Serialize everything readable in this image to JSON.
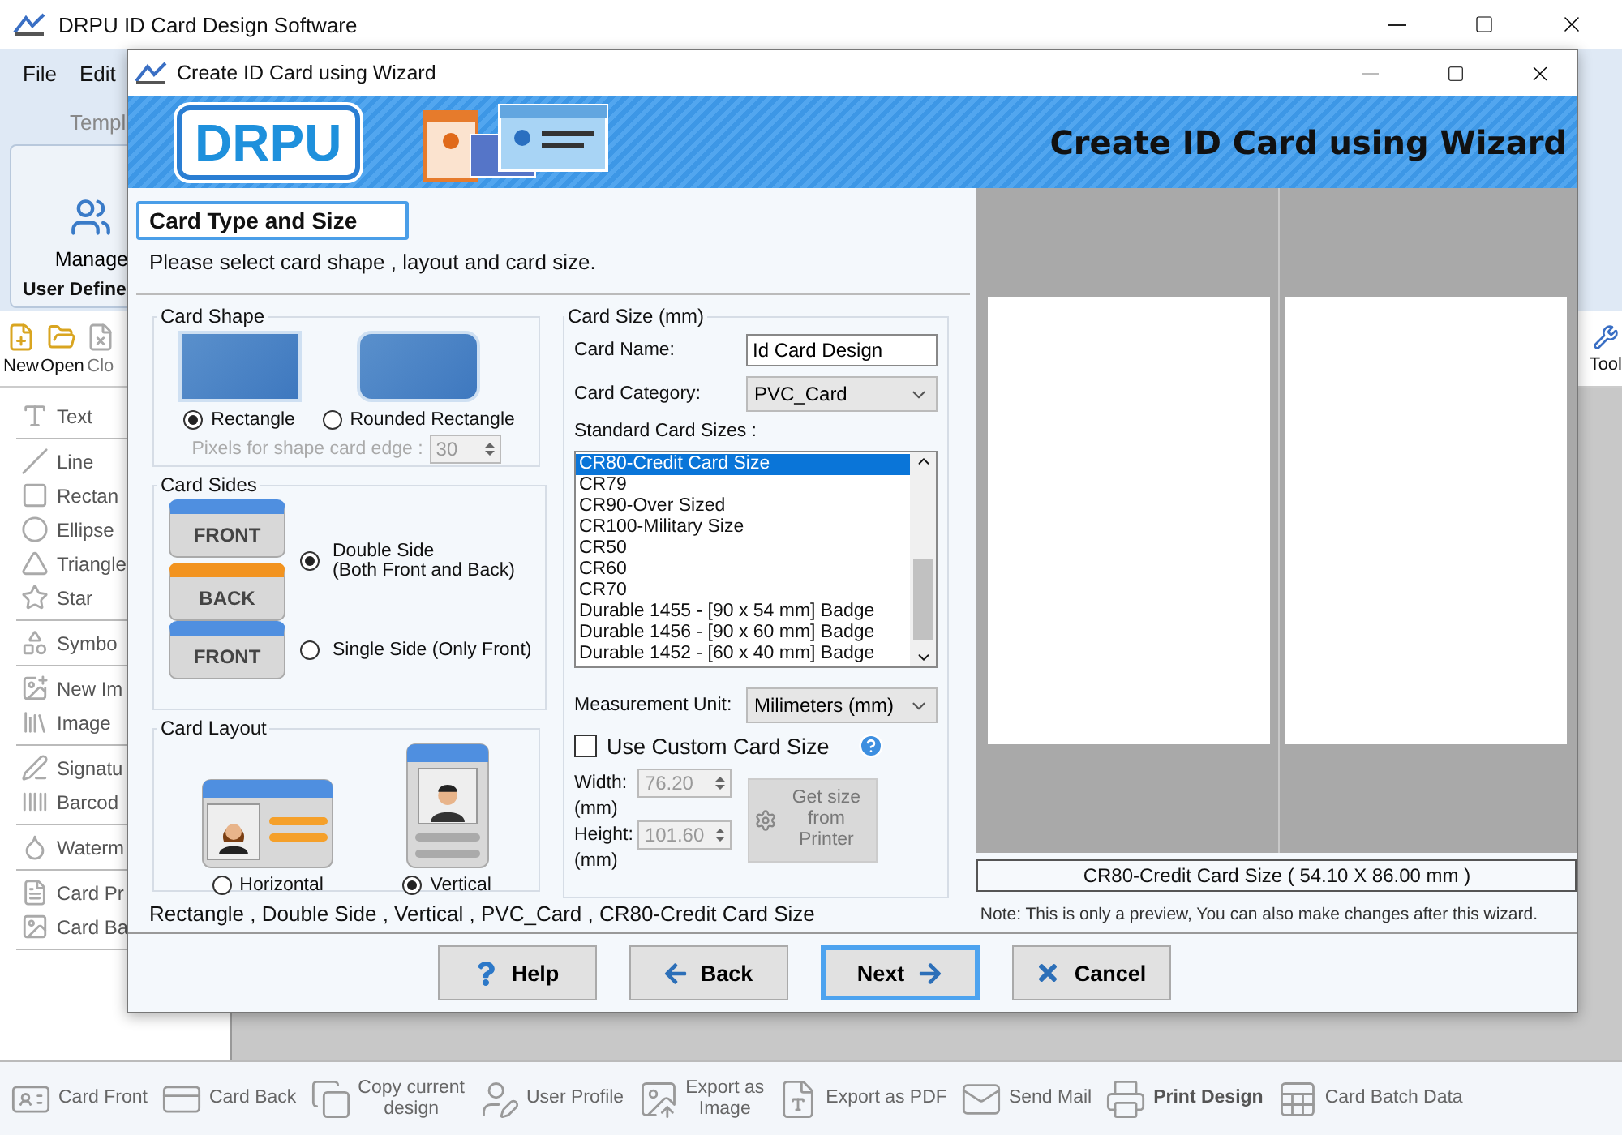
{
  "app": {
    "title": "DRPU ID Card Design Software",
    "menu": [
      "File",
      "Edit"
    ],
    "ribbon_tab": "Templ",
    "ribbon_group": {
      "button": "Manage",
      "label": "User Define"
    },
    "toolbar": [
      {
        "label": "New",
        "disabled": false
      },
      {
        "label": "Open",
        "disabled": false
      },
      {
        "label": "Clo",
        "disabled": true
      }
    ],
    "toolbar_right": "Tool",
    "tool_groups": [
      {
        "items": [
          "Text"
        ]
      },
      {
        "items": [
          "Line",
          "Rectan",
          "Ellipse",
          "Triangle",
          "Star"
        ]
      },
      {
        "items": [
          "Symbo"
        ]
      },
      {
        "items": [
          "New Im",
          "Image"
        ]
      },
      {
        "items": [
          "Signatu",
          "Barcod"
        ]
      },
      {
        "items": [
          "Waterm"
        ]
      },
      {
        "items": [
          "Card Pr",
          "Card Ba"
        ]
      }
    ],
    "bottom_bar": [
      {
        "label": "Card Front",
        "selected": false
      },
      {
        "label": "Card Back",
        "selected": false
      },
      {
        "label": "Copy current\ndesign",
        "selected": false
      },
      {
        "label": "User Profile",
        "selected": false
      },
      {
        "label": "Export as\nImage",
        "selected": false
      },
      {
        "label": "Export as PDF",
        "selected": false
      },
      {
        "label": "Send Mail",
        "selected": false
      },
      {
        "label": "Print Design",
        "selected": true
      },
      {
        "label": "Card Batch Data",
        "selected": false
      }
    ]
  },
  "dialog": {
    "title": "Create ID Card using Wizard",
    "logo": "DRPU",
    "heading": "Create ID Card using Wizard",
    "step_title": "Card Type and Size",
    "instruction": "Please select card shape , layout and card size.",
    "card_shape": {
      "title": "Card Shape",
      "options": [
        {
          "label": "Rectangle",
          "selected": true,
          "kind": "rectangle"
        },
        {
          "label": "Rounded Rectangle",
          "selected": false,
          "kind": "rounded"
        }
      ],
      "edge_label": "Pixels for shape card edge :",
      "edge_value": "30",
      "edge_disabled": true
    },
    "card_sides": {
      "title": "Card Sides",
      "options": [
        {
          "label": "Double Side",
          "sublabel": "(Both Front and Back)",
          "selected": true,
          "cards": [
            {
              "text": "FRONT",
              "kind": "front"
            },
            {
              "text": "BACK",
              "kind": "back"
            }
          ]
        },
        {
          "label": "Single Side (Only Front)",
          "selected": false,
          "cards": [
            {
              "text": "FRONT",
              "kind": "front"
            }
          ]
        }
      ]
    },
    "card_layout": {
      "title": "Card Layout",
      "options": [
        {
          "label": "Horizontal",
          "selected": false,
          "kind": "horizontal"
        },
        {
          "label": "Vertical",
          "selected": true,
          "kind": "vertical"
        }
      ]
    },
    "card_size": {
      "title": "Card Size (mm)",
      "name_label": "Card Name:",
      "name_value": "Id Card Design",
      "category_label": "Card Category:",
      "category_value": "PVC_Card",
      "sizes_label": "Standard Card Sizes :",
      "sizes": [
        {
          "label": "CR80-Credit Card Size",
          "selected": true
        },
        {
          "label": "CR79",
          "selected": false
        },
        {
          "label": "CR90-Over Sized",
          "selected": false
        },
        {
          "label": "CR100-Military Size",
          "selected": false
        },
        {
          "label": "CR50",
          "selected": false
        },
        {
          "label": "CR60",
          "selected": false
        },
        {
          "label": "CR70",
          "selected": false
        },
        {
          "label": "Durable 1455 - [90 x 54 mm] Badge",
          "selected": false
        },
        {
          "label": "Durable 1456 - [90 x 60 mm] Badge",
          "selected": false
        },
        {
          "label": "Durable 1452 - [60 x 40 mm] Badge",
          "selected": false
        }
      ],
      "unit_label": "Measurement Unit:",
      "unit_value": "Milimeters (mm)",
      "custom_label": "Use Custom Card Size",
      "custom_checked": false,
      "width_label": "Width:",
      "width_unit": "(mm)",
      "width_value": "76.20",
      "height_label": "Height:",
      "height_unit": "(mm)",
      "height_value": "101.60",
      "printer_button": "Get size from Printer"
    },
    "summary": "Rectangle , Double Side , Vertical , PVC_Card , CR80-Credit Card Size",
    "preview": {
      "caption": "CR80-Credit Card Size ( 54.10 X 86.00 mm )",
      "note": "Note: This is only a preview, You can also make changes after this wizard."
    },
    "buttons": [
      {
        "label": "Help",
        "kind": "help",
        "focused": false
      },
      {
        "label": "Back",
        "kind": "back",
        "focused": false
      },
      {
        "label": "Next",
        "kind": "next",
        "focused": true
      },
      {
        "label": "Cancel",
        "kind": "cancel",
        "focused": false
      }
    ]
  }
}
